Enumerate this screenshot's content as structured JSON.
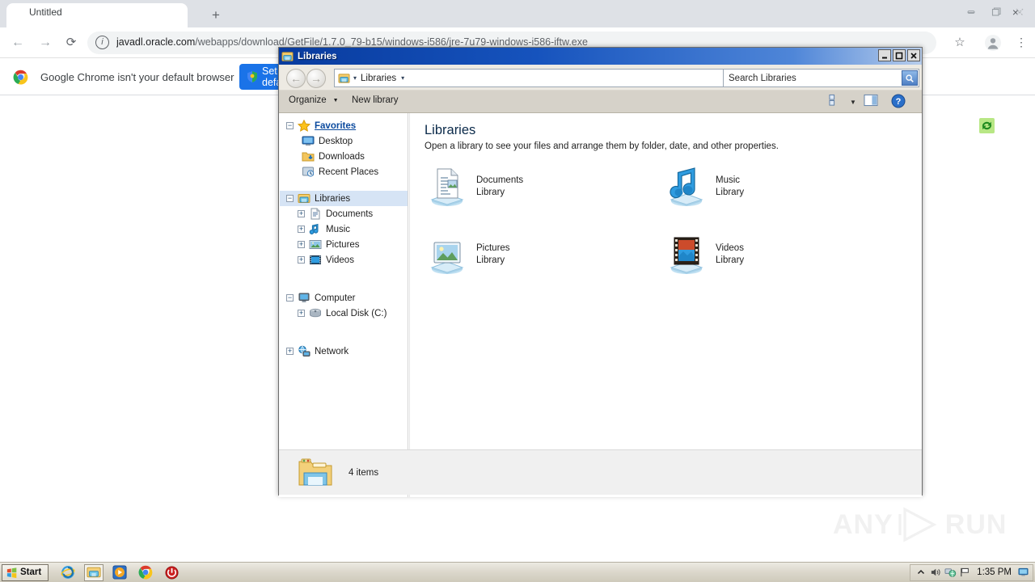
{
  "browser": {
    "tab_title": "Untitled",
    "tab_close": "×",
    "new_tab": "+",
    "nav_back": "←",
    "nav_forward": "→",
    "reload": "⟳",
    "info_icon": "i",
    "url_host": "javadl.oracle.com",
    "url_path": "/webapps/download/GetFile/1.7.0_79-b15/windows-i586/jre-7u79-windows-i586-iftw.exe",
    "star": "☆",
    "menu": "⋮",
    "infobar_text": "Google Chrome isn't your default browser",
    "infobar_button": "Set as default",
    "infobar_close": "×"
  },
  "explorer": {
    "title": "Libraries",
    "minimize": "_",
    "maximize": "□",
    "close": "✕",
    "breadcrumb": {
      "caret": "▾",
      "label": "Libraries",
      "caret2": "▾",
      "dropdown": "▾"
    },
    "search_placeholder": "Search Libraries",
    "commands": {
      "organize": "Organize",
      "organize_caret": "▼",
      "new_library": "New library",
      "view_caret": "▼"
    },
    "nav_tree": [
      {
        "label": "Favorites",
        "glyph": "−",
        "icon": "star-icon",
        "style": "fav",
        "indent": 0
      },
      {
        "label": "Desktop",
        "glyph": "",
        "icon": "desktop-icon",
        "style": "",
        "indent": 1
      },
      {
        "label": "Downloads",
        "glyph": "",
        "icon": "downloads-icon",
        "style": "",
        "indent": 1
      },
      {
        "label": "Recent Places",
        "glyph": "",
        "icon": "recent-places-icon",
        "style": "",
        "indent": 1
      },
      {
        "label": "Libraries",
        "glyph": "−",
        "icon": "libraries-icon",
        "style": "selected",
        "indent": 0
      },
      {
        "label": "Documents",
        "glyph": "+",
        "icon": "documents-icon",
        "style": "",
        "indent": 2
      },
      {
        "label": "Music",
        "glyph": "+",
        "icon": "music-icon",
        "style": "",
        "indent": 2
      },
      {
        "label": "Pictures",
        "glyph": "+",
        "icon": "pictures-icon",
        "style": "",
        "indent": 2
      },
      {
        "label": "Videos",
        "glyph": "+",
        "icon": "videos-icon",
        "style": "",
        "indent": 2
      },
      {
        "label": "Computer",
        "glyph": "−",
        "icon": "computer-icon",
        "style": "",
        "indent": 0
      },
      {
        "label": "Local Disk (C:)",
        "glyph": "+",
        "icon": "harddisk-icon",
        "style": "",
        "indent": 2
      },
      {
        "label": "Network",
        "glyph": "+",
        "icon": "network-icon",
        "style": "",
        "indent": 0
      }
    ],
    "content": {
      "heading": "Libraries",
      "subtitle": "Open a library to see your files and arrange them by folder, date, and other properties.",
      "items": [
        {
          "name": "Documents",
          "kind": "Library",
          "icon": "documents-library-icon"
        },
        {
          "name": "Music",
          "kind": "Library",
          "icon": "music-library-icon"
        },
        {
          "name": "Pictures",
          "kind": "Library",
          "icon": "pictures-library-icon"
        },
        {
          "name": "Videos",
          "kind": "Library",
          "icon": "videos-library-icon"
        }
      ]
    },
    "status": "4 items"
  },
  "watermark": {
    "left": "ANY",
    "right": "RUN"
  },
  "taskbar": {
    "start": "Start",
    "clock": "1:35 PM",
    "quick_launch": [
      {
        "name": "internet-explorer-icon"
      },
      {
        "name": "windows-explorer-icon",
        "active": true
      },
      {
        "name": "media-player-icon"
      },
      {
        "name": "chrome-icon"
      },
      {
        "name": "shutdown-icon"
      }
    ],
    "tray": [
      {
        "name": "show-hidden-icons-icon",
        "glyph": "⌃"
      },
      {
        "name": "volume-icon"
      },
      {
        "name": "network-tray-icon"
      },
      {
        "name": "action-center-flag-icon"
      }
    ]
  },
  "colors": {
    "chrome_blue": "#1a73e8",
    "title_blue": "#0b3f9e",
    "selection_blue": "#d6e4f5",
    "taskbar_gray": "#dbd7cb"
  }
}
